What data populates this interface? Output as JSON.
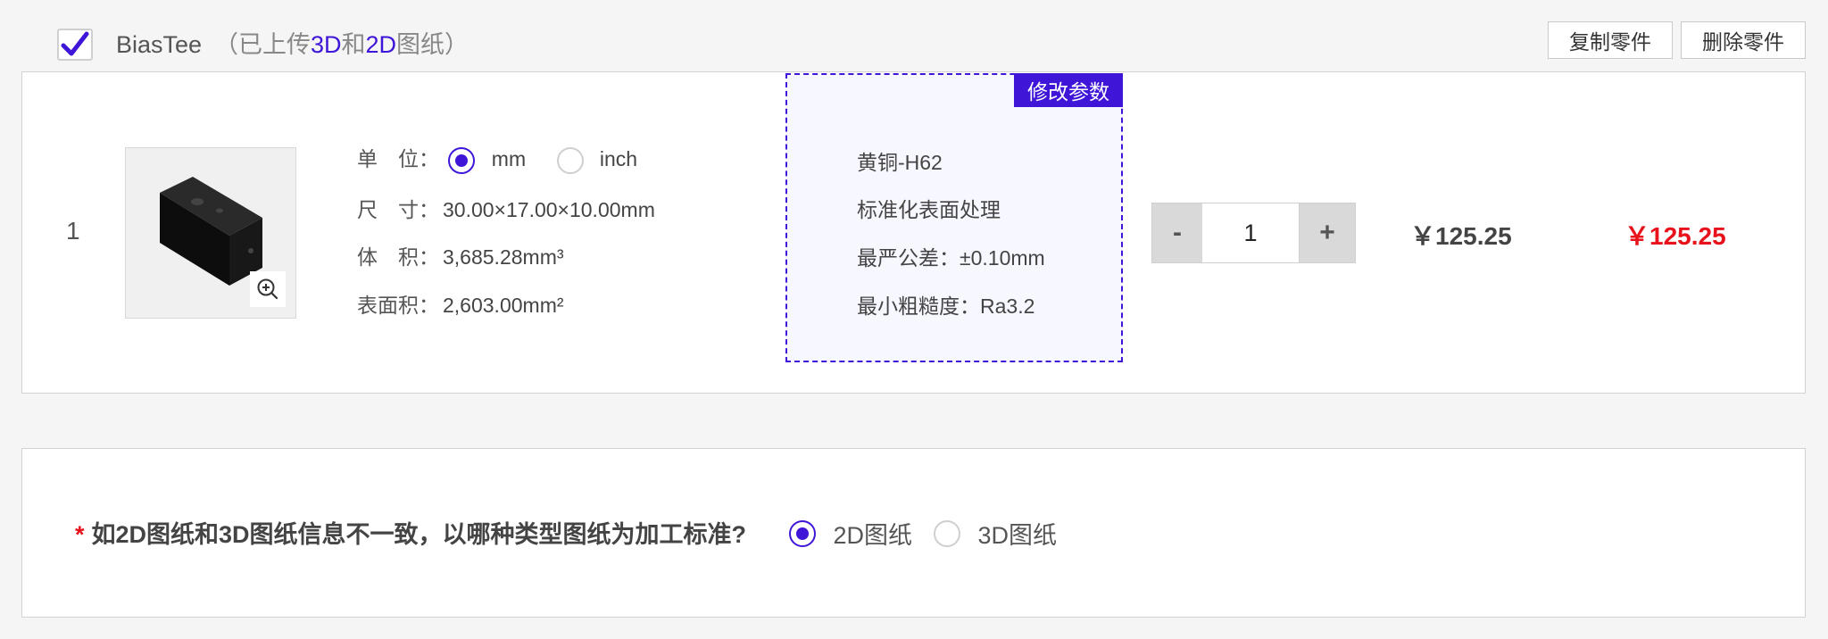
{
  "part": {
    "checked": true,
    "name": "BiasTee",
    "upload_note_prefix": "（已上传",
    "upload_note_3d": "3D",
    "upload_note_and": "和",
    "upload_note_2d": "2D",
    "upload_note_suffix": "图纸）",
    "copy_label": "复制零件",
    "delete_label": "删除零件"
  },
  "row": {
    "index": "1",
    "unit_label": "单　位：",
    "unit_options": [
      "mm",
      "inch"
    ],
    "unit_selected": "mm",
    "size_label": "尺　寸：",
    "size_value": "30.00×17.00×10.00mm",
    "volume_label": "体　积：",
    "volume_value": "3,685.28mm³",
    "area_label": "表面积：",
    "area_value": "2,603.00mm²"
  },
  "material": {
    "edit_label": "修改参数",
    "lines": [
      "黄铜-H62",
      "标准化表面处理",
      "最严公差：±0.10mm",
      "最小粗糙度：Ra3.2"
    ]
  },
  "quantity": {
    "minus_label": "-",
    "value": "1",
    "plus_label": "+"
  },
  "pricing": {
    "unit_price": "￥125.25",
    "total_price": "￥125.25"
  },
  "question": {
    "required_mark": "*",
    "text": "如2D图纸和3D图纸信息不一致，以哪种类型图纸为加工标准?",
    "options": [
      "2D图纸",
      "3D图纸"
    ],
    "selected": "2D图纸"
  },
  "colors": {
    "accent": "#3f16d8",
    "price_red": "#e8121c"
  }
}
